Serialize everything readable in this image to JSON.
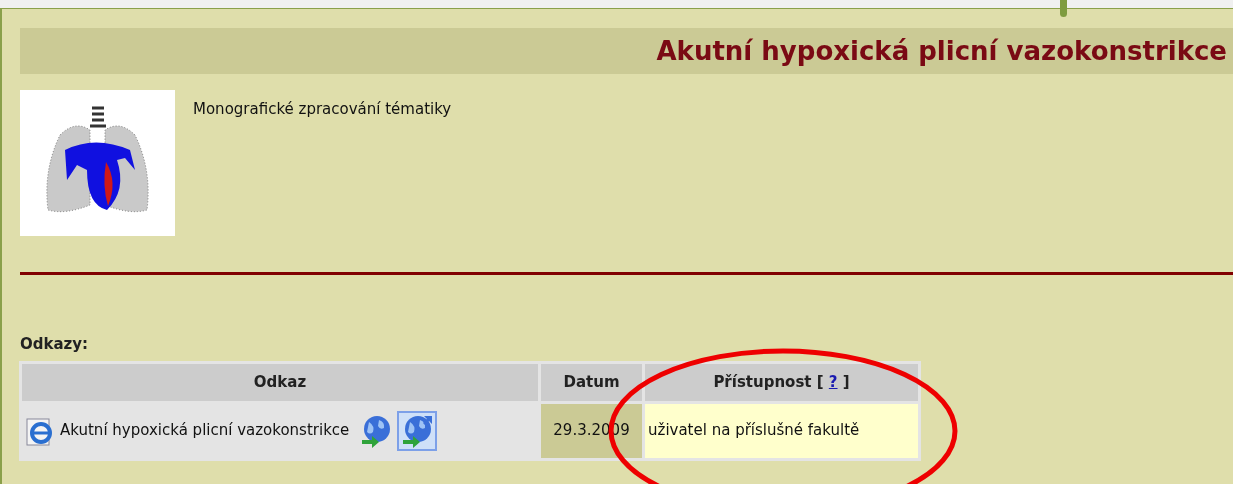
{
  "page": {
    "title": "Akutní hypoxická plicní vazokonstrikce",
    "description": "Monografické zpracování tématiky"
  },
  "links": {
    "heading": "Odkazy:",
    "columns": [
      {
        "kind": "plain",
        "label": "Odkaz"
      },
      {
        "kind": "plain",
        "label": "Datum"
      },
      {
        "kind": "help",
        "prefix": "Přístupnost [",
        "link": "?",
        "suffix": "]"
      }
    ],
    "rows": [
      {
        "title": "Akutní hypoxická plicní vazokonstrikce",
        "date": "29.3.2009",
        "access": "uživatel na příslušné fakultě"
      }
    ]
  }
}
